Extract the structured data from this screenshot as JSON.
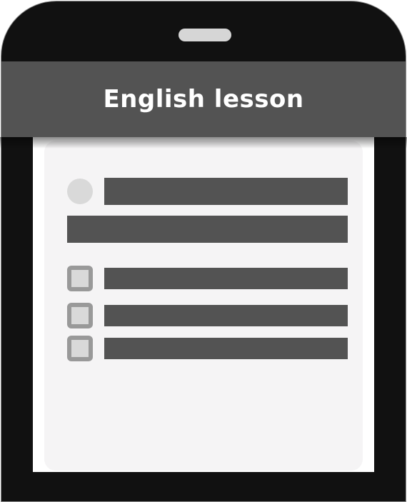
{
  "header": {
    "title": "English lesson"
  },
  "colors": {
    "frame": "#111111",
    "header": "#535353",
    "card": "#f5f4f5",
    "placeholder_bar": "#535353",
    "checkbox_border": "#999999",
    "checkbox_fill": "#d9d9d9"
  },
  "checklist": [
    {
      "checked": false
    },
    {
      "checked": false
    },
    {
      "checked": false
    }
  ]
}
